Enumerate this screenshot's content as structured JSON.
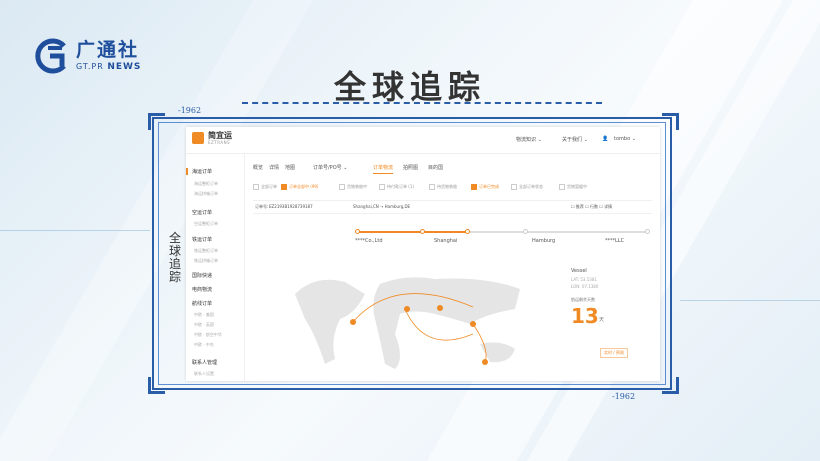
{
  "logo": {
    "cn": "广通社",
    "en_prefix": "GT.PR",
    "en_suffix": "NEWS"
  },
  "title": "全球追踪",
  "frame_mark": "-1962",
  "side_title": "全球追踪",
  "app": {
    "brand_cn": "简宜运",
    "brand_en": "EZTRANS",
    "header": {
      "menu1": "物流知识 ⌄",
      "menu2": "关于我们 ⌄",
      "user": "tombo ⌄"
    },
    "sidebar": [
      {
        "label": "海运订单",
        "subs": [
          "海运整柜订单",
          "海运拼箱订单"
        ]
      },
      {
        "label": "空运订单",
        "subs": [
          "空运整柜订单"
        ]
      },
      {
        "label": "铁运订单",
        "subs": [
          "铁运整柜订单",
          "铁运拼箱订单"
        ]
      },
      {
        "label": "国际快递",
        "subs": []
      },
      {
        "label": "电商物流",
        "subs": []
      },
      {
        "label": "航线订单",
        "subs": [
          "中欧 · 美国",
          "中欧 · 英国",
          "中欧 · 航空中华",
          "中欧 · 中东"
        ]
      },
      {
        "label": "联系人管理",
        "subs": [
          "联系人设置"
        ]
      }
    ],
    "tabs": [
      "概览",
      "详情",
      "地图",
      "订单号/PO号 ⌄",
      "订单物流",
      "拍照图",
      "目的国"
    ],
    "filters": [
      "全部订单",
      "订单全部中 (99)",
      "货物装舱中",
      "待付款订单 (1)",
      "待货物装舱",
      "订单已完成",
      "全部订单状态",
      "货物暂缓中"
    ],
    "order_no_label": "订单号:",
    "order_no": "EZ2193B1928739187",
    "route_text": "Shanghai,CN → Hamburg,DE",
    "actions": "☐ 推荐  ☐ 行数  ☐ 详情",
    "nodes": [
      "****Co.,Ltd",
      "Shanghai",
      "Hamburg",
      "****LLC"
    ],
    "vessel": "Vessel",
    "vessel_lat": "LAT: 53.5381",
    "vessel_lon": "LON: 07.1380",
    "remaining_label": "航运剩余天数",
    "remaining_days": "13",
    "days_unit": "天",
    "legend": "实时 / 预测"
  },
  "colors": {
    "accent": "#f08a24",
    "frame": "#2a5da8"
  }
}
